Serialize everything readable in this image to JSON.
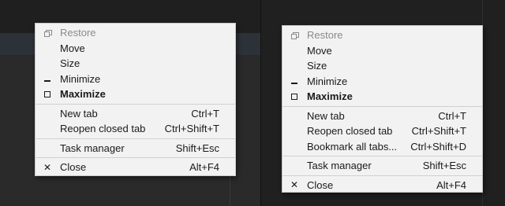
{
  "menu_left": {
    "restore": "Restore",
    "move": "Move",
    "size": "Size",
    "minimize": "Minimize",
    "maximize": "Maximize",
    "new_tab": "New tab",
    "new_tab_shortcut": "Ctrl+T",
    "reopen": "Reopen closed tab",
    "reopen_shortcut": "Ctrl+Shift+T",
    "task_manager": "Task manager",
    "task_manager_shortcut": "Shift+Esc",
    "close": "Close",
    "close_shortcut": "Alt+F4"
  },
  "menu_right": {
    "restore": "Restore",
    "move": "Move",
    "size": "Size",
    "minimize": "Minimize",
    "maximize": "Maximize",
    "new_tab": "New tab",
    "new_tab_shortcut": "Ctrl+T",
    "reopen": "Reopen closed tab",
    "reopen_shortcut": "Ctrl+Shift+T",
    "bookmark_all": "Bookmark all tabs...",
    "bookmark_all_shortcut": "Ctrl+Shift+D",
    "task_manager": "Task manager",
    "task_manager_shortcut": "Shift+Esc",
    "close": "Close",
    "close_shortcut": "Alt+F4"
  },
  "icons": {
    "restore": "restore-icon",
    "minimize": "minimize-icon",
    "maximize": "maximize-icon",
    "close": "close-icon",
    "close_glyph": "✕"
  },
  "colors": {
    "menu_background": "#f2f2f2",
    "disabled_text": "#8a8a8a",
    "text": "#1a1a1a"
  }
}
